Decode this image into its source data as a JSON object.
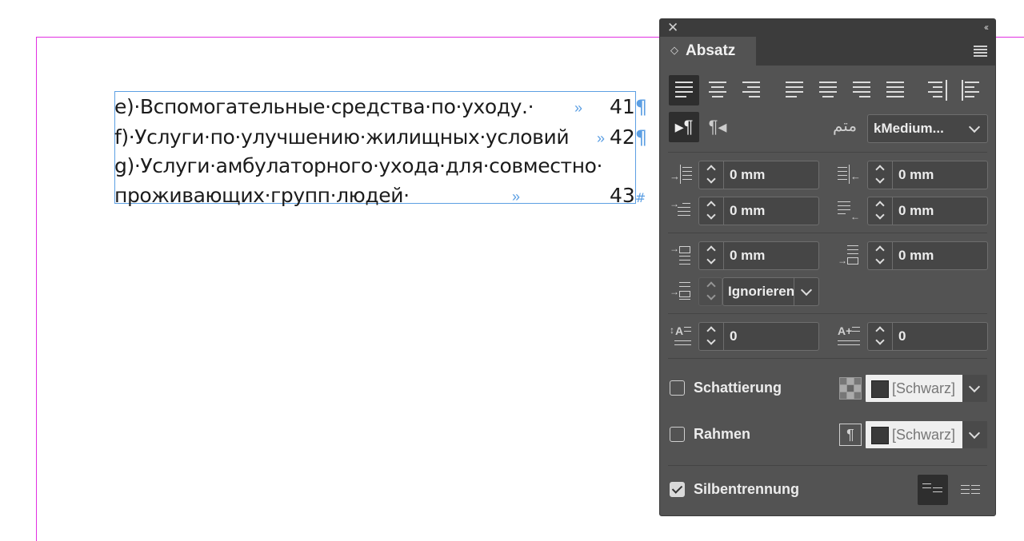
{
  "document": {
    "lines": [
      {
        "text": "e)·Вспомогательные·средства·по·уходу.·",
        "page": "41"
      },
      {
        "text": "f)·Услуги·по·улучшению·жилищных·условий",
        "page": "42"
      },
      {
        "text": "g)·Услуги·амбулаторного·ухода·для·совместно·",
        "page": ""
      },
      {
        "text": "проживающих·групп·людей·",
        "page": "43"
      }
    ],
    "pilcrow": "¶",
    "end_mark": "#",
    "tab_glyph": "»"
  },
  "panel": {
    "close_glyph": "✕",
    "collapse_glyph": "‹‹",
    "tab_arrows": "◇",
    "tab_label": "Absatz",
    "direction_ltr": "▸¶",
    "direction_rtl": "¶◂",
    "composer_icon": "arabic-kashida-icon",
    "composer_glyph": "متم",
    "composer_value": "kMedium...",
    "left_indent": "0 mm",
    "right_indent": "0 mm",
    "first_line_indent": "0 mm",
    "last_line_indent": "0 mm",
    "space_before": "0 mm",
    "space_after": "0 mm",
    "align_to_grid": "Ignorieren",
    "drop_cap_lines": "0",
    "drop_cap_chars": "0",
    "shading_label": "Schattierung",
    "shading_checked": false,
    "shading_swatch": "[Schwarz]",
    "border_label": "Rahmen",
    "border_checked": false,
    "border_swatch": "[Schwarz]",
    "hyphenate_label": "Silbentrennung",
    "hyphenate_checked": true,
    "colors": {
      "panel_bg": "#535353",
      "panel_header": "#3c3c3c",
      "field_bg": "#464646",
      "guide": "#e22fe2",
      "frame": "#5c9fe3"
    }
  }
}
